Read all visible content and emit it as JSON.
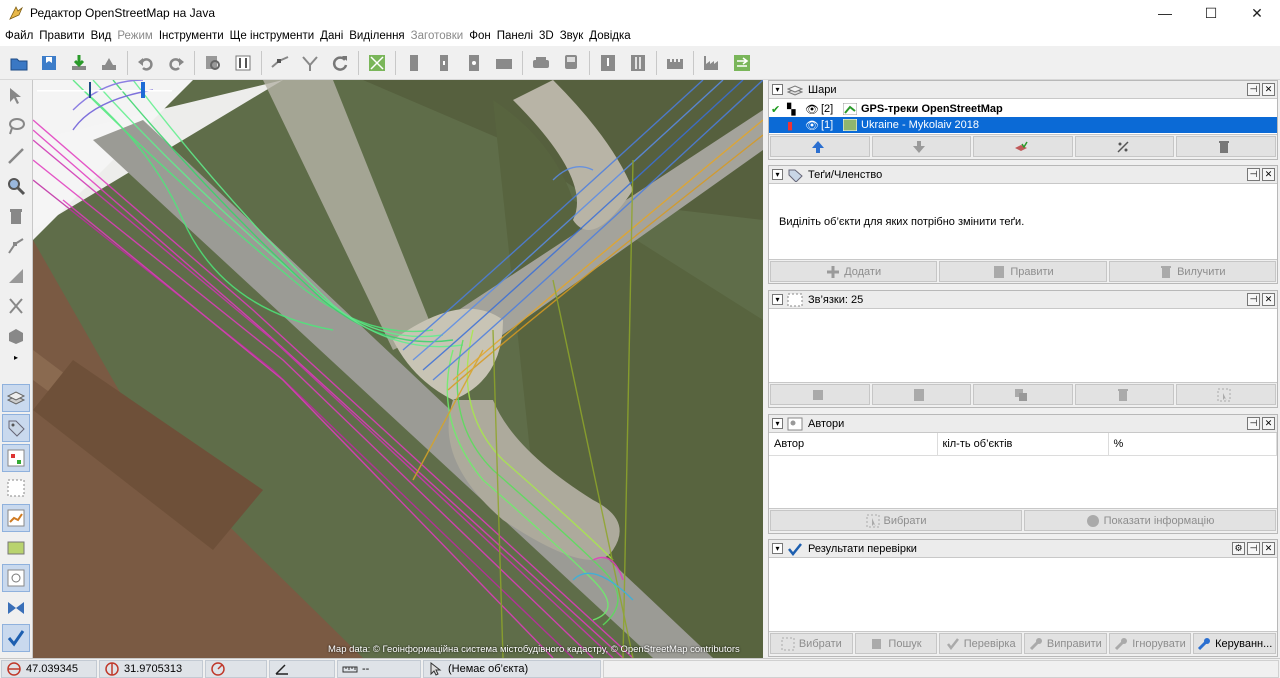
{
  "window": {
    "title": "Редактор OpenStreetMap на Java",
    "minimize": "—",
    "maximize": "☐",
    "close": "✕"
  },
  "menu": [
    {
      "label": "Файл",
      "enabled": true
    },
    {
      "label": "Правити",
      "enabled": true
    },
    {
      "label": "Вид",
      "enabled": true
    },
    {
      "label": "Режим",
      "enabled": false
    },
    {
      "label": "Інструменти",
      "enabled": true
    },
    {
      "label": "Ще інструменти",
      "enabled": true
    },
    {
      "label": "Дані",
      "enabled": true
    },
    {
      "label": "Виділення",
      "enabled": true
    },
    {
      "label": "Заготовки",
      "enabled": false
    },
    {
      "label": "Фон",
      "enabled": true
    },
    {
      "label": "Панелі",
      "enabled": true
    },
    {
      "label": "3D",
      "enabled": true
    },
    {
      "label": "Звук",
      "enabled": true
    },
    {
      "label": "Довідка",
      "enabled": true
    }
  ],
  "map": {
    "attribution": "Map data: © Геоінформаційна система містобудівного кадастру, © OpenStreetMap contributors"
  },
  "panels": {
    "layers": {
      "title": "Шари",
      "rows": [
        {
          "index": "[2]",
          "name": "GPS-треки OpenStreetMap",
          "bold": true
        },
        {
          "index": "[1]",
          "name": "Ukraine - Mykolaiv 2018",
          "bold": false
        }
      ]
    },
    "tags": {
      "title": "Теґи/Членство",
      "message": "Виділіть об’єкти для яких потрібно змінити теґи.",
      "buttons": {
        "add": "Додати",
        "edit": "Правити",
        "delete": "Вилучити"
      }
    },
    "relations": {
      "title": "Зв’язки: 25"
    },
    "authors": {
      "title": "Автори",
      "columns": {
        "author": "Автор",
        "count": "кіл-ть об’єктів",
        "percent": "%"
      },
      "buttons": {
        "select": "Вибрати",
        "info": "Показати інформацію"
      }
    },
    "validation": {
      "title": "Результати перевірки",
      "buttons": {
        "select": "Вибрати",
        "search": "Пошук",
        "validate": "Перевірка",
        "fix": "Виправити",
        "ignore": "Ігнорувати",
        "manage": "Керуванн..."
      }
    }
  },
  "status": {
    "lat": "47.039345",
    "lon": "31.9705313",
    "heading": "",
    "angle": "",
    "distance": "--",
    "object": "(Немає об’єкта)"
  }
}
